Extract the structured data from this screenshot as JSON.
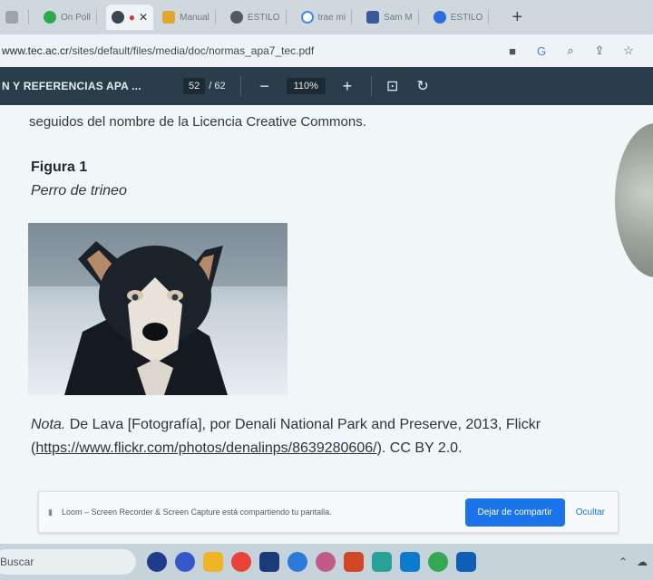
{
  "tabs": [
    {
      "label": "",
      "color": "#7a8a93"
    },
    {
      "label": "On Poll",
      "color": "#2fa84f"
    },
    {
      "label": "",
      "color": "#3a4650",
      "active": true
    },
    {
      "label": "Manual",
      "color": "#e2a72f"
    },
    {
      "label": "ESTILO",
      "color": "#4f5a62"
    },
    {
      "label": "trae mi",
      "color": "#4285f4"
    },
    {
      "label": "Sam M",
      "color": "#3b5998"
    },
    {
      "label": "ESTILO",
      "color": "#2d6cdf"
    }
  ],
  "address": {
    "host": "www.tec.ac.cr",
    "path": "/sites/default/files/media/doc/normas_apa7_tec.pdf"
  },
  "pdf_toolbar": {
    "title": "N Y REFERENCIAS APA ...",
    "page_current": "52",
    "page_total": "/ 62",
    "zoom": "110%"
  },
  "document": {
    "cut_line": "seguidos del nombre de la Licencia Creative Commons.",
    "figure_label": "Figura 1",
    "figure_title": "Perro de trineo",
    "note_prefix": "Nota.",
    "note_text": " De Lava [Fotografía], por Denali National Park and Preserve, 2013, Flickr (",
    "note_link": "https://www.flickr.com/photos/denalinps/8639280606/",
    "note_suffix": "). CC BY 2.0."
  },
  "share_banner": {
    "message": "Loom – Screen Recorder & Screen Capture está compartiendo tu pantalla.",
    "stop_label": "Dejar de compartir",
    "hide_label": "Ocultar"
  },
  "taskbar": {
    "search_placeholder": "Buscar"
  },
  "colors": {
    "pdf_toolbar": "#2a3d4a",
    "accent": "#1a73e8"
  }
}
